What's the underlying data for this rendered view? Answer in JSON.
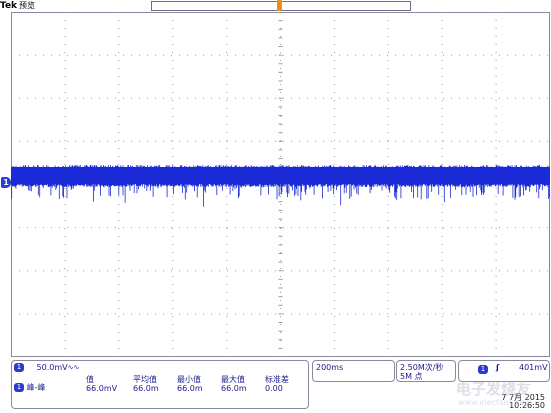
{
  "header": {
    "brand": "Tek",
    "mode": "预览"
  },
  "screen": {
    "colors": {
      "waveform": "#1a2ad6",
      "grid": "#9a9aa8",
      "border": "#8a8a9a",
      "trigger_marker": "#f08c1a",
      "accent": "#2b3ad0"
    },
    "channel_marker_label": "1"
  },
  "channel": {
    "number": "1",
    "scale": "50.0mV",
    "bw_symbol": "ᴮᵂ"
  },
  "measurement": {
    "channel": "1",
    "name": "峰-峰",
    "headers": [
      "值",
      "平均值",
      "最小值",
      "最大值",
      "标准差"
    ],
    "values": [
      "66.0mV",
      "66.0m",
      "66.0m",
      "66.0m",
      "0.00"
    ]
  },
  "timebase": {
    "value": "200ms"
  },
  "acquisition": {
    "rate": "2.50M次/秒",
    "length": "5M 点"
  },
  "trigger": {
    "channel": "1",
    "edge_icon": "rising-edge",
    "edge_symbol": "∴",
    "level": "401mV"
  },
  "datetime": {
    "date": "7 7月  2015",
    "time": "10:26:50"
  },
  "watermark": {
    "text": "电子发烧友",
    "url": "www.elecfans.com"
  }
}
